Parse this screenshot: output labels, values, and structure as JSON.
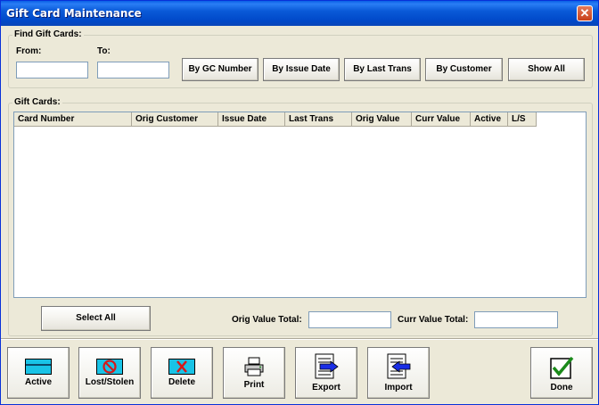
{
  "window": {
    "title": "Gift Card Maintenance",
    "close_symbol": "✕"
  },
  "find": {
    "legend": "Find Gift Cards:",
    "from_label": "From:",
    "to_label": "To:",
    "from_value": "",
    "to_value": "",
    "buttons": [
      "By GC Number",
      "By Issue Date",
      "By Last Trans",
      "By Customer",
      "Show All"
    ]
  },
  "cards": {
    "legend": "Gift Cards:",
    "columns": [
      "Card Number",
      "Orig Customer",
      "Issue Date",
      "Last Trans",
      "Orig Value",
      "Curr Value",
      "Active",
      "L/S"
    ],
    "rows": []
  },
  "totals": {
    "select_all_label": "Select All",
    "orig_label": "Orig Value Total:",
    "curr_label": "Curr Value Total:",
    "orig_value": "",
    "curr_value": ""
  },
  "toolbar": {
    "active": "Active",
    "lost_stolen": "Lost/Stolen",
    "delete": "Delete",
    "print": "Print",
    "export": "Export",
    "import": "Import",
    "done": "Done"
  },
  "colors": {
    "title_bar": "#0a5ad8",
    "face": "#ece9d8",
    "card_cyan": "#19c3e6",
    "card_red": "#d81818",
    "arrow_blue": "#1a2ee6",
    "check_green": "#1a8a1a"
  }
}
